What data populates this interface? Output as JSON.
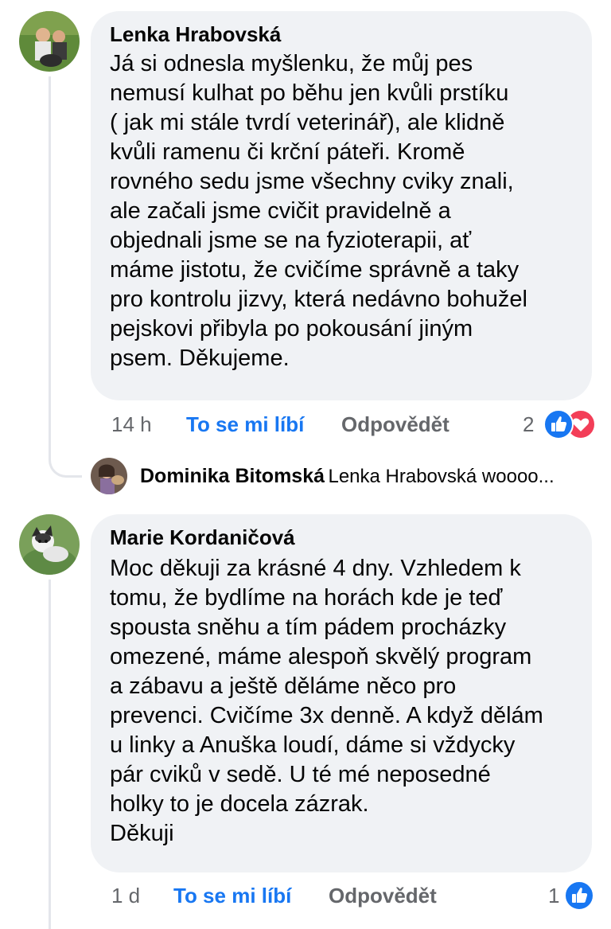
{
  "comments": [
    {
      "author": "Lenka Hrabovská",
      "lines": [
        "Já si odnesla myšlenku, že můj pes",
        "nemusí kulhat po běhu jen kvůli prstíku",
        "( jak mi stále tvrdí veterinář), ale klidně",
        "kvůli ramenu či krční páteři. Kromě",
        "rovného sedu jsme všechny cviky znali,",
        "ale začali jsme cvičit pravidelně a",
        "objednali jsme se na fyzioterapii, ať",
        "máme jistotu, že cvičíme správně a taky",
        "pro kontrolu jizvy, která nedávno bohužel",
        "pejskovi přibyla po pokousání jiným",
        "psem. Děkujeme."
      ],
      "time": "14 h",
      "like_label": "To se mi líbí",
      "reply_label": "Odpovědět",
      "reaction_count": "2",
      "reactions": [
        "like-icon",
        "love-icon"
      ],
      "reply_preview": {
        "author": "Dominika Bitomská",
        "snippet": "Lenka Hrabovská woooo..."
      }
    },
    {
      "author": "Marie Kordaničová",
      "lines": [
        "Moc děkuji za krásné 4 dny. Vzhledem k",
        "tomu, že bydlíme na horách kde je teď",
        "spousta sněhu a tím pádem procházky",
        "omezené, máme alespoň skvělý program",
        "a zábavu a ještě děláme něco pro",
        "prevenci. Cvičíme 3x denně. A když dělám",
        "u linky a Anuška loudí, dáme si vždycky",
        "pár cviků v sedě. U té mé neposedné",
        "holky to je docela zázrak.",
        "Děkuji"
      ],
      "time": "1 d",
      "like_label": "To se mi líbí",
      "reply_label": "Odpovědět",
      "reaction_count": "1",
      "reactions": [
        "like-icon"
      ]
    }
  ],
  "colors": {
    "bubble": "#f0f2f5",
    "link_blue": "#1877f2",
    "meta_gray": "#65676b",
    "love_red": "#f33e58",
    "thread_line": "#e4e6eb"
  }
}
